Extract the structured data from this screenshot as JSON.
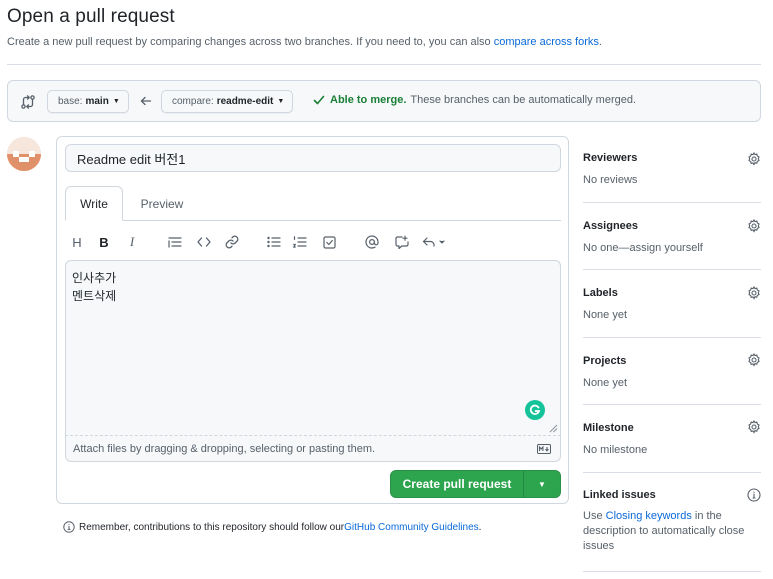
{
  "page": {
    "title": "Open a pull request",
    "subtitle_prefix": "Create a new pull request by comparing changes across two branches. If you need to, you can also ",
    "subtitle_link": "compare across forks",
    "subtitle_suffix": "."
  },
  "compare": {
    "base_label": "base:",
    "base_value": "main",
    "compare_label": "compare:",
    "compare_value": "readme-edit",
    "merge_ok": "Able to merge.",
    "merge_desc": "These branches can be automatically merged."
  },
  "form": {
    "title_value": "Readme edit 버전1",
    "tabs": {
      "write": "Write",
      "preview": "Preview"
    },
    "body_text": "인사추가\n멘트삭제",
    "attach_text": "Attach files by dragging & dropping, selecting or pasting them.",
    "toolbar": {
      "heading": "H",
      "bold": "B",
      "italic": "I"
    },
    "create_label": "Create pull request"
  },
  "footer": {
    "remember_prefix": "Remember, contributions to this repository should follow our ",
    "remember_link": "GitHub Community Guidelines",
    "remember_suffix": "."
  },
  "sidebar": {
    "reviewers": {
      "title": "Reviewers",
      "value": "No reviews"
    },
    "assignees": {
      "title": "Assignees",
      "value": "No one—assign yourself"
    },
    "labels": {
      "title": "Labels",
      "value": "None yet"
    },
    "projects": {
      "title": "Projects",
      "value": "None yet"
    },
    "milestone": {
      "title": "Milestone",
      "value": "No milestone"
    },
    "linked_issues": {
      "title": "Linked issues",
      "prefix": "Use ",
      "link": "Closing keywords",
      "suffix": " in the description to automatically close issues"
    }
  },
  "colors": {
    "accent": "#0969da",
    "success": "#1a7f37",
    "button_green": "#2da44e",
    "grammarly": "#15c39a"
  },
  "icons": [
    "git-compare-icon",
    "arrow-left-icon",
    "check-icon",
    "gear-icon",
    "info-icon",
    "markdown-icon",
    "grammarly-icon",
    "triangle-down-icon"
  ]
}
